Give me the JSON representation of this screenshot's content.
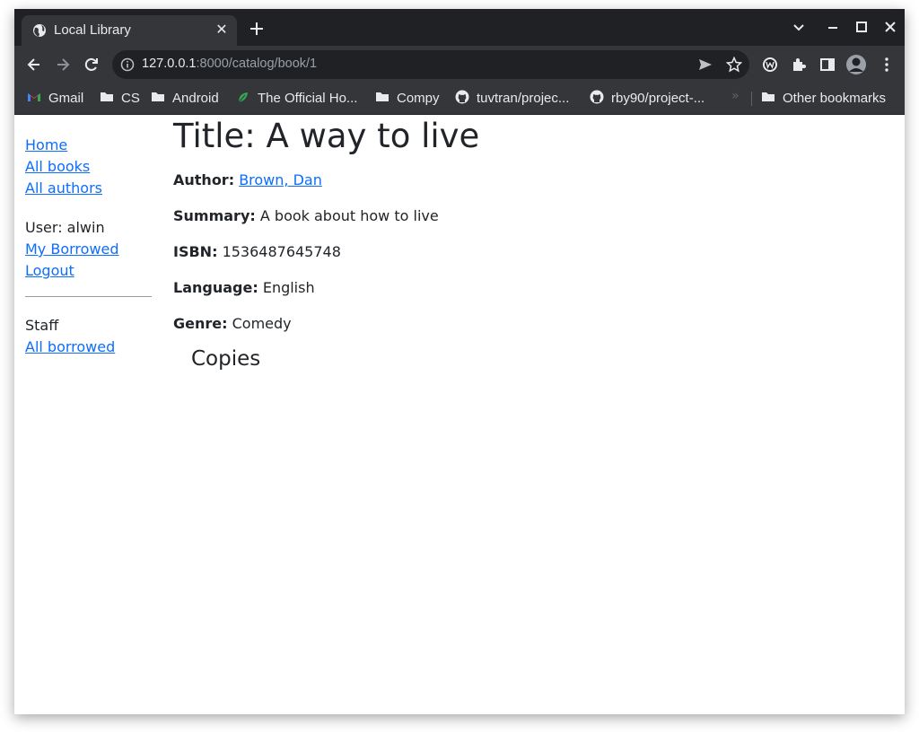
{
  "browser": {
    "tab_title": "Local Library",
    "tab_close": "✕",
    "url_host": "127.0.0.1",
    "url_rest": ":8000/catalog/book/1",
    "bookmarks": [
      {
        "label": "Gmail",
        "icon": "gmail-icon"
      },
      {
        "label": "CS",
        "icon": "folder-icon"
      },
      {
        "label": "Android",
        "icon": "folder-icon"
      },
      {
        "label": "The Official Ho...",
        "icon": "leaf-icon"
      },
      {
        "label": "Compy",
        "icon": "folder-icon"
      },
      {
        "label": "tuvtran/projec...",
        "icon": "github-icon"
      },
      {
        "label": "rby90/project-...",
        "icon": "github-icon"
      }
    ],
    "bookmarks_more": "»",
    "other_bookmarks": "Other bookmarks"
  },
  "sidebar": {
    "home": "Home",
    "all_books": "All books",
    "all_authors": "All authors",
    "user": "User: alwin",
    "my_borrowed": "My Borrowed",
    "logout": "Logout",
    "staff": "Staff",
    "all_borrowed": "All borrowed"
  },
  "book": {
    "title": "Title: A way to live",
    "author_label": "Author:",
    "author": "Brown, Dan",
    "summary_label": "Summary:",
    "summary": "A book about how to live",
    "isbn_label": "ISBN:",
    "isbn": "1536487645748",
    "language_label": "Language:",
    "language": "English",
    "genre_label": "Genre:",
    "genre": "Comedy",
    "copies_heading": "Copies"
  },
  "colors": {
    "link": "#0d6efd",
    "chrome_dark": "#202124",
    "chrome_toolbar": "#35363a"
  }
}
